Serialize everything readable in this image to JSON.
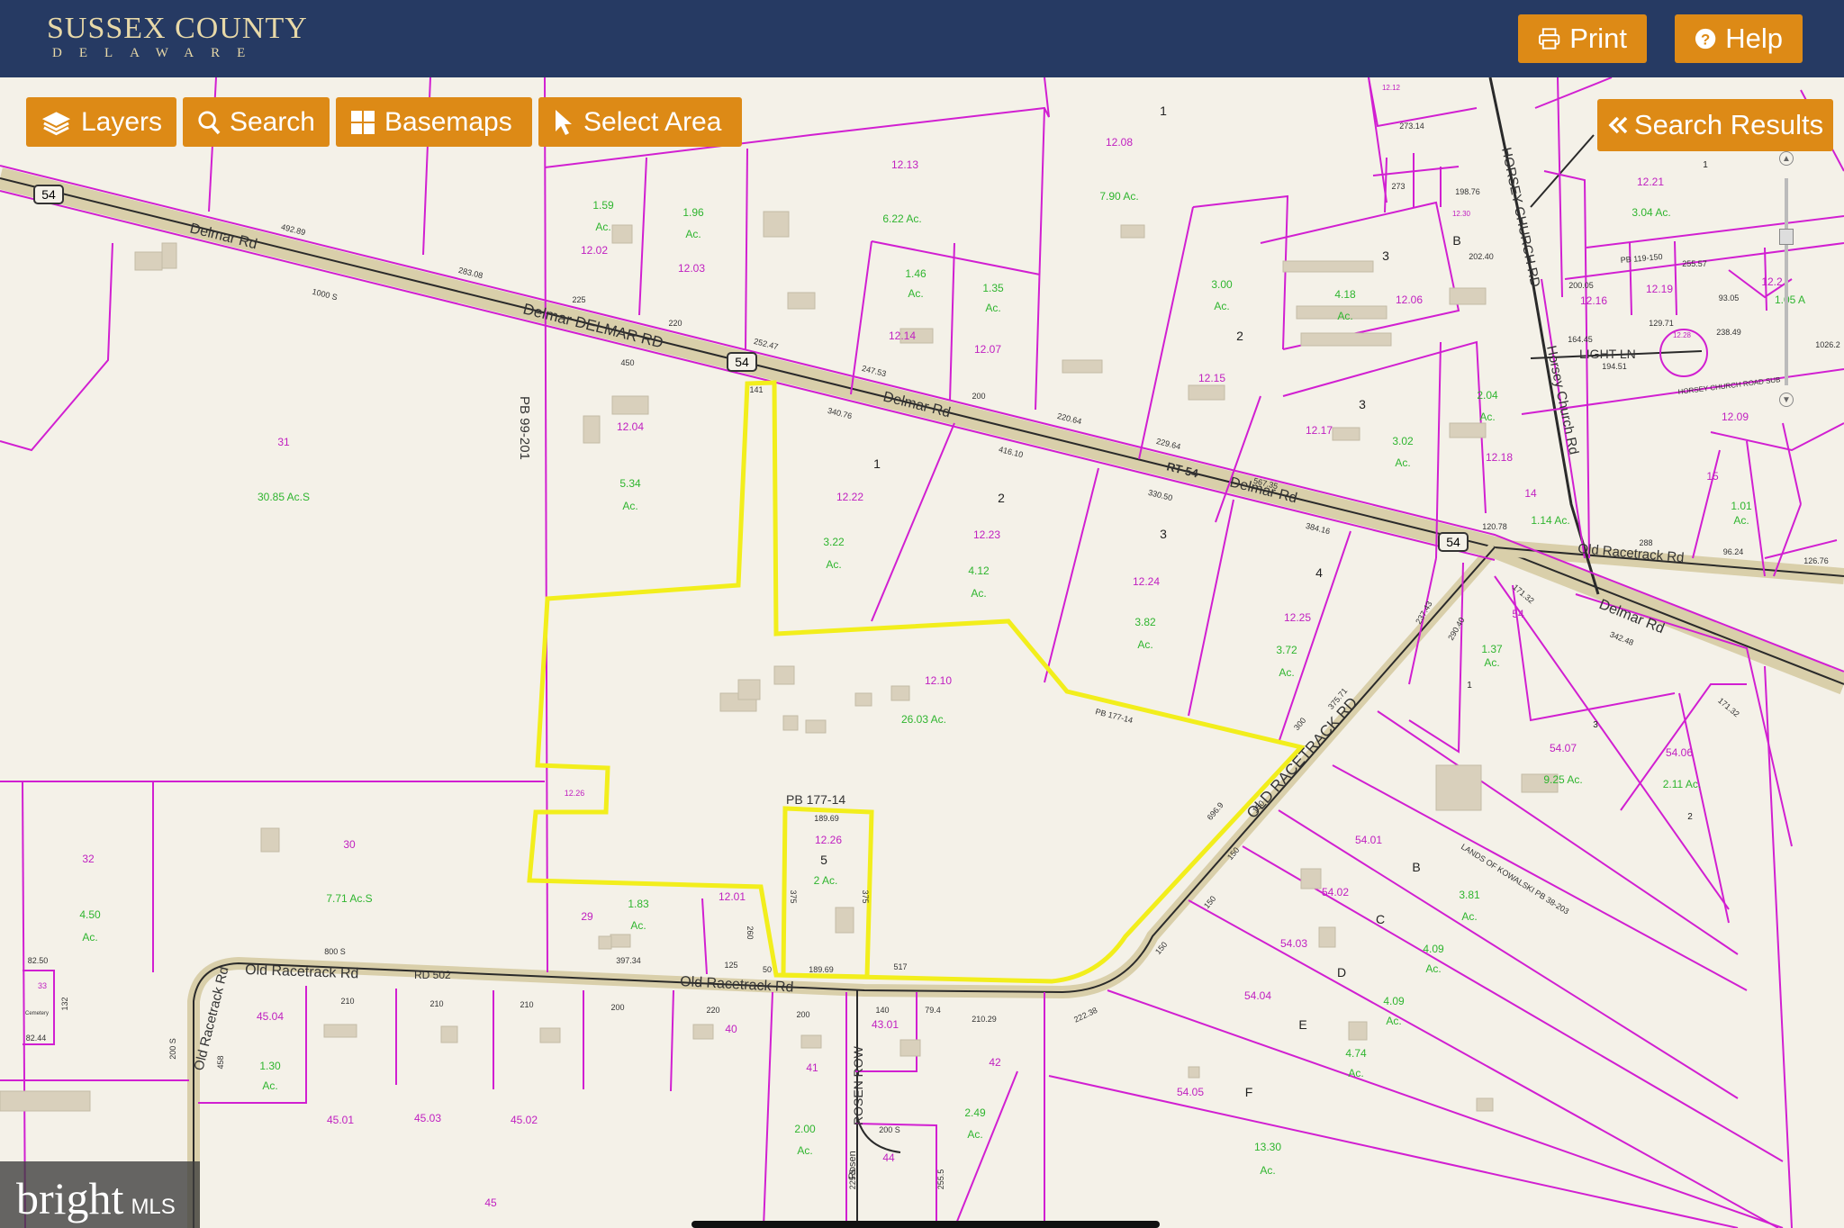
{
  "header": {
    "brand_title": "SUSSEX COUNTY",
    "brand_subtitle": "DELAWARE",
    "print_label": "Print",
    "help_label": "Help"
  },
  "toolbar": {
    "layers_label": "Layers",
    "search_label": "Search",
    "basemaps_label": "Basemaps",
    "select_area_label": "Select Area"
  },
  "search_results_label": "Search Results",
  "watermark": {
    "brand": "bright",
    "suffix": "MLS"
  },
  "colors": {
    "header_bg": "#263a63",
    "button": "#dd8a16",
    "parcel_line": "#d11fd1",
    "selected_parcel": "#f2ee1c",
    "acreage_text": "#2fb52f"
  },
  "map": {
    "road_labels": {
      "delmar_rd_w": "Delmar Rd",
      "delmar_rd_big": "Delmar DELMAR RD",
      "delmar_rd_mid": "Delmar Rd",
      "rt54": "RT 54",
      "delmar_rd_e": "Delmar Rd",
      "delmar_rd_se": "Delmar Rd",
      "old_racetrack_e": "Old Racetrack Rd",
      "old_racetrack_big": "OLD RACETRACK RD",
      "old_racetrack_s": "Old Racetrack Rd",
      "old_racetrack_w": "Old Racetrack Rd",
      "rd502": "RD 502",
      "old_racetrack_curve": "Old Racetrack Rd",
      "horsey_church": "HORSEY CHURCH RD",
      "horsey_church_rd": "Horsey Church Rd",
      "light_ln": "LIGHT LN",
      "horsey_church_small": "HORSEY CHURCH ROAD SUB",
      "rosen_row": "ROSEN ROW",
      "rosen_small": "Rosen",
      "route_shield_w": "54",
      "route_shield_mid": "54",
      "route_shield_e": "54"
    },
    "plat_labels": {
      "pb99": "PB 99-201",
      "pb177": "PB 177-14",
      "pb177_small": "PB 177-14",
      "kowalski": "LANDS OF KOWALSKI PB 38-203",
      "pb119": "PB 119-150",
      "cemetery": "Cemetery"
    },
    "parcel_ids": {
      "p1202": "12.02",
      "p1203": "12.03",
      "p1213": "12.13",
      "p1208": "12.08",
      "p1214": "12.14",
      "p1207": "12.07",
      "p1204": "12.04",
      "p31": "31",
      "p1222": "12.22",
      "p1223": "12.23",
      "p1224": "12.24",
      "p1225": "12.25",
      "p1215": "12.15",
      "p1217": "12.17",
      "p1218": "12.18",
      "p1206": "12.06",
      "p1221": "12.21",
      "p1219": "12.19",
      "p1216": "12.16",
      "p1220": "12.2",
      "p1209": "12.09",
      "p1210": "12.10",
      "p1226": "12.26",
      "p1226b": "12.26",
      "p1201": "12.01",
      "p29": "29",
      "p30": "30",
      "p32": "32",
      "p33": "33",
      "p54": "54",
      "p5407": "54.07",
      "p5406": "54.06",
      "p5401": "54.01",
      "p5402": "54.02",
      "p5403": "54.03",
      "p5404": "54.04",
      "p5405": "54.05",
      "p4504": "45.04",
      "p4501": "45.01",
      "p4503": "45.03",
      "p4502": "45.02",
      "p45": "45",
      "p40": "40",
      "p41": "41",
      "p4301": "43.01",
      "p42": "42",
      "p44": "44",
      "p14": "14",
      "p15": "15",
      "p1212": "12.12",
      "p1228": "12.28",
      "p1230": "12.30"
    },
    "acreage_labels": {
      "a159": "1.59",
      "a159ac": "Ac.",
      "a196": "1.96",
      "a196ac": "Ac.",
      "a622": "6.22 Ac.",
      "a790": "7.90 Ac.",
      "a146": "1.46",
      "a146ac": "Ac.",
      "a135": "1.35",
      "a135ac": "Ac.",
      "a534": "5.34",
      "a534ac": "Ac.",
      "a3085": "30.85 Ac.S",
      "a322": "3.22",
      "a322ac": "Ac.",
      "a412": "4.12",
      "a412ac": "Ac.",
      "a382": "3.82",
      "a382ac": "Ac.",
      "a372": "3.72",
      "a372ac": "Ac.",
      "a300": "3.00",
      "a300ac": "Ac.",
      "a418": "4.18",
      "a418ac": "Ac.",
      "a302": "3.02",
      "a302ac": "Ac.",
      "a204": "2.04",
      "a204ac": "Ac.",
      "a304": "3.04 Ac.",
      "a105": "1.05 A",
      "a2603": "26.03 Ac.",
      "a2ac": "2 Ac.",
      "a183": "1.83",
      "a183ac": "Ac.",
      "a771": "7.71 Ac.S",
      "a450": "4.50",
      "a450ac": "Ac.",
      "a137": "1.37",
      "a137ac": "Ac.",
      "a925": "9.25 Ac.",
      "a211": "2.11 Ac.",
      "a381": "3.81",
      "a381ac": "Ac.",
      "a409a": "4.09",
      "a409aac": "Ac.",
      "a409b": "4.09",
      "a409bac": "Ac.",
      "a474": "4.74",
      "a474ac": "Ac.",
      "a1330": "13.30",
      "a1330ac": "Ac.",
      "a130": "1.30",
      "a130ac": "Ac.",
      "a200": "2.00",
      "a200ac": "Ac.",
      "a249": "2.49",
      "a249ac": "Ac.",
      "a114": "1.14 Ac.",
      "a101": "1.01",
      "a101ac": "Ac."
    },
    "lot_numbers": {
      "l1": "1",
      "l1b": "1",
      "l2": "2",
      "l2b": "2",
      "l3": "3",
      "l3b": "3",
      "l3c": "3",
      "l4": "4",
      "l5": "5",
      "lB": "B",
      "lBb": "B",
      "lC": "C",
      "lD": "D",
      "lE": "E",
      "lF": "F",
      "l1c": "1",
      "l2c": "2",
      "l3d": "3",
      "l1d": "1"
    },
    "dimensions": {
      "d49289": "492.89",
      "d1000s": "1000 S",
      "d28308": "283.08",
      "d225": "225",
      "d220": "220",
      "d450": "450",
      "d25247": "252.47",
      "d24753": "247.53",
      "d200": "200",
      "d141": "141",
      "d34076": "340.76",
      "d41610": "416.10",
      "d22064": "220.64",
      "d22964": "229.64",
      "d33050": "330.50",
      "d56735": "567.35",
      "d38416": "384.16",
      "d12078": "120.78",
      "d18969": "189.69",
      "d18969b": "189.69",
      "d375": "375",
      "d375b": "375",
      "d260": "260",
      "d517": "517",
      "d50": "50",
      "d125": "125",
      "d39734": "397.34",
      "d800s": "800 S",
      "d8250": "82.50",
      "d8244": "82.44",
      "d132": "132",
      "d210a": "210",
      "d210b": "210",
      "d210c": "210",
      "d200b": "200",
      "d220b": "220",
      "d200c": "200",
      "d140": "140",
      "d794": "79.4",
      "d21029": "210.29",
      "d200s": "200 S",
      "d2255": "225.5",
      "d2555": "255.5",
      "d458": "458",
      "d200sb": "200 S",
      "d150": "150",
      "d150b": "150",
      "d150c": "150",
      "d150d": "150",
      "d6969": "696.9",
      "d300": "300",
      "d37571": "375.71",
      "d23743": "237.43",
      "d29040": "290.40",
      "d17132": "171.32",
      "d34248": "342.48",
      "d17132b": "171.32",
      "d22238": "222.38",
      "d27314": "273.14",
      "d273": "273",
      "d19876": "198.76",
      "d20240": "202.40",
      "d20005": "200.05",
      "d25557": "255.57",
      "d9305": "93.05",
      "d16445": "164.45",
      "d19451": "194.51",
      "d12971": "129.71",
      "d23849": "238.49",
      "d10262": "1026.2",
      "d9624": "96.24",
      "d288": "288",
      "d12676": "126.76"
    }
  }
}
